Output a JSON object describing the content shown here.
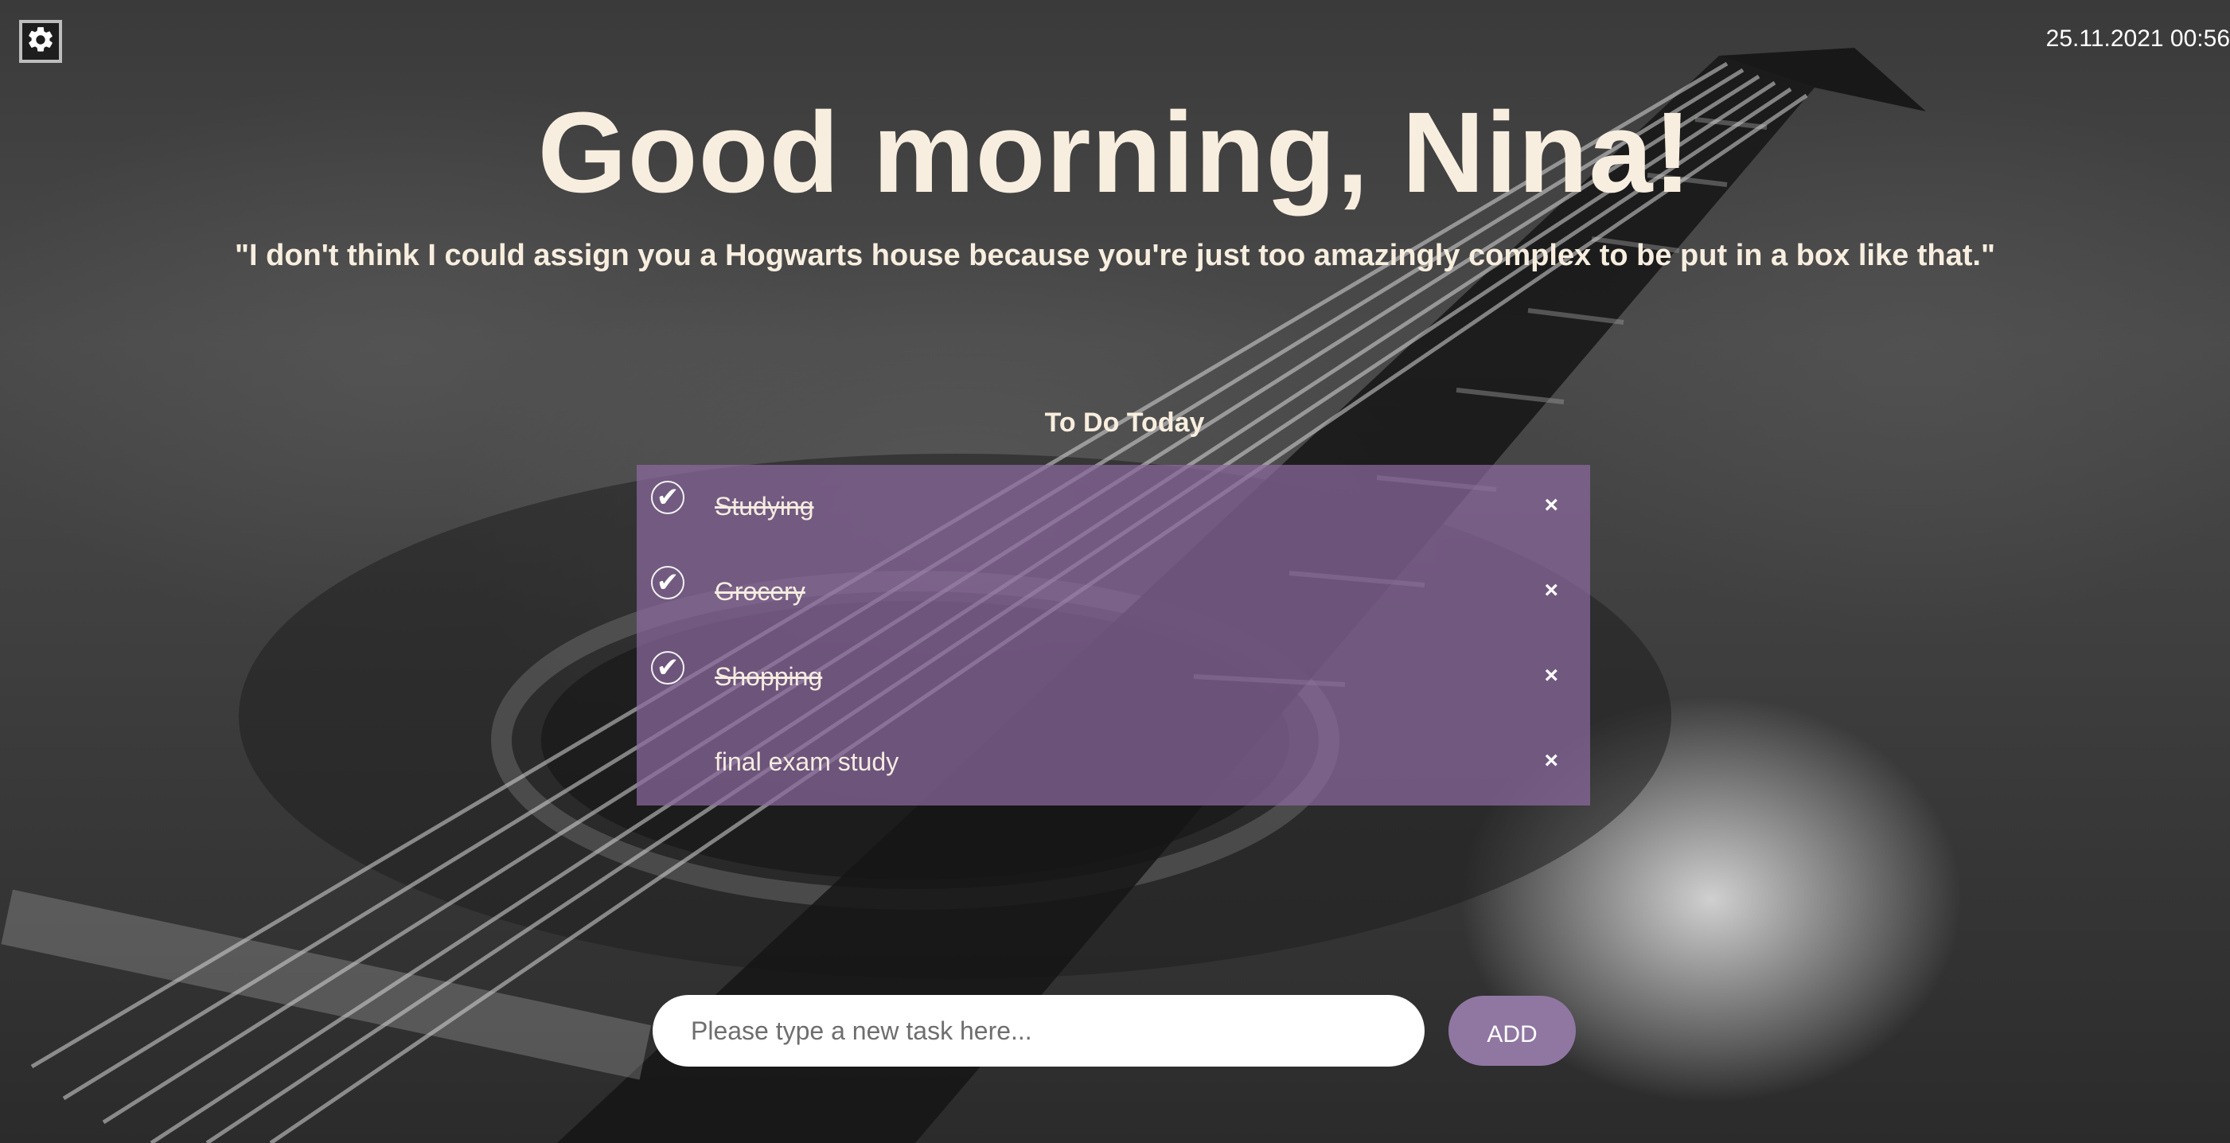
{
  "app": {
    "datetime": "25.11.2021 00:56"
  },
  "icons": {
    "settings": "gear-icon",
    "check": "checkmark-icon",
    "remove": "close-icon"
  },
  "greeting": "Good morning, Nina!",
  "quote": "\"I don't think I could assign you a Hogwarts house because you're just too amazingly complex to be put in a box like that.\"",
  "todo": {
    "title": "To Do Today",
    "items": [
      {
        "label": "Studying",
        "done": true
      },
      {
        "label": "Grocery",
        "done": true
      },
      {
        "label": "Shopping",
        "done": true
      },
      {
        "label": "final exam study",
        "done": false
      }
    ],
    "check_glyph": "✔",
    "remove_glyph": "×"
  },
  "new_task": {
    "placeholder": "Please type a new task here...",
    "value": "",
    "add_label": "ADD"
  },
  "colors": {
    "panel": "#8c69a0",
    "add_button": "#9077a2",
    "text_cream": "#f8eedf"
  }
}
